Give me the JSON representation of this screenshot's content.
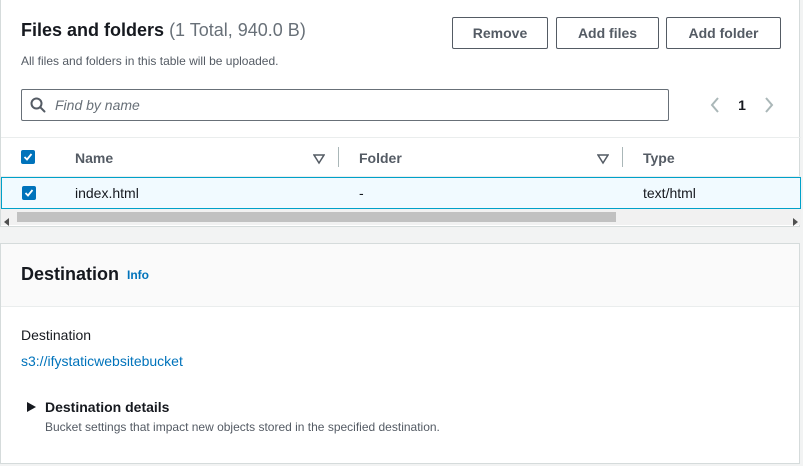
{
  "files_panel": {
    "title": "Files and folders",
    "count": "(1 Total, 940.0 B)",
    "description": "All files and folders in this table will be uploaded.",
    "buttons": {
      "remove": "Remove",
      "add_files": "Add files",
      "add_folder": "Add folder"
    },
    "search": {
      "placeholder": "Find by name",
      "value": "",
      "icon": "search-icon"
    },
    "pagination": {
      "current_page": "1",
      "prev_icon": "chevron-left-icon",
      "next_icon": "chevron-right-icon"
    },
    "table": {
      "columns": [
        "Name",
        "Folder",
        "Type"
      ],
      "header_checkbox_checked": true,
      "rows": [
        {
          "selected": true,
          "name": "index.html",
          "folder": "-",
          "type": "text/html"
        }
      ]
    }
  },
  "destination_panel": {
    "title": "Destination",
    "info_link": "Info",
    "destination_label": "Destination",
    "destination_url": "s3://ifystaticwebsitebucket",
    "details": {
      "title": "Destination details",
      "description": "Bucket settings that impact new objects stored in the specified destination.",
      "expanded": false
    }
  },
  "colors": {
    "accent": "#0073bb",
    "selected_row_bg": "#f1faff",
    "selected_row_border": "#00a1c9",
    "page_bg": "#f2f3f3"
  }
}
